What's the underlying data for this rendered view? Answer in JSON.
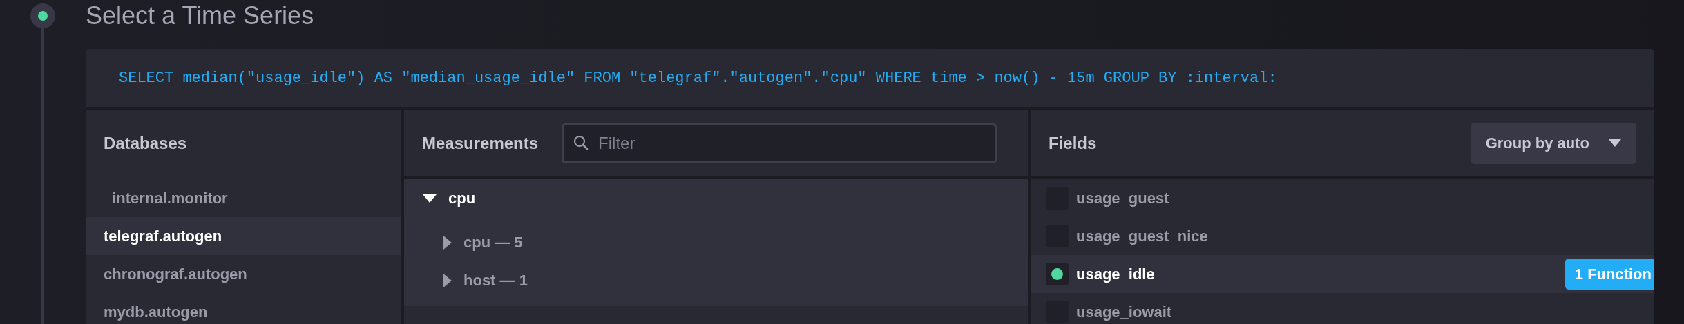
{
  "step": {
    "active": true,
    "title": "Select a Time Series"
  },
  "query": "SELECT median(\"usage_idle\") AS \"median_usage_idle\" FROM \"telegraf\".\"autogen\".\"cpu\" WHERE time > now() - 15m GROUP BY :interval:",
  "databases": {
    "heading": "Databases",
    "items": [
      {
        "label": "_internal.monitor",
        "selected": false
      },
      {
        "label": "telegraf.autogen",
        "selected": true
      },
      {
        "label": "chronograf.autogen",
        "selected": false
      },
      {
        "label": "mydb.autogen",
        "selected": false
      }
    ]
  },
  "measurements": {
    "heading": "Measurements",
    "filter": {
      "placeholder": "Filter"
    },
    "items": [
      {
        "label": "cpu",
        "expanded": true,
        "selected": true,
        "children": [
          {
            "label": "cpu — 5",
            "expanded": false
          },
          {
            "label": "host — 1",
            "expanded": false
          }
        ]
      }
    ]
  },
  "fields": {
    "heading": "Fields",
    "group_by": "Group by auto",
    "items": [
      {
        "label": "usage_guest",
        "checked": false
      },
      {
        "label": "usage_guest_nice",
        "checked": false
      },
      {
        "label": "usage_idle",
        "checked": true,
        "badge": "1 Function"
      },
      {
        "label": "usage_iowait",
        "checked": false
      }
    ]
  }
}
